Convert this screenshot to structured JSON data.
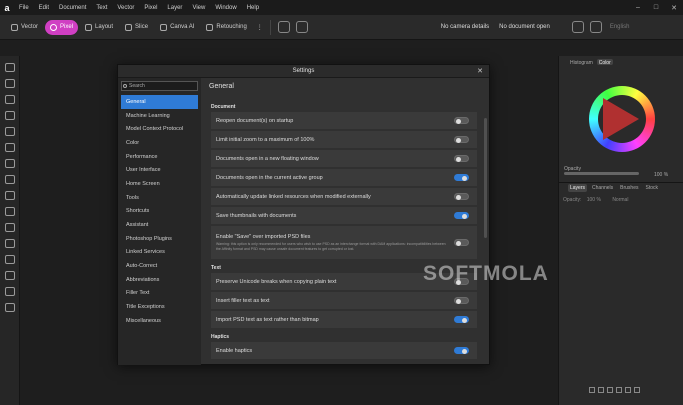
{
  "menubar": {
    "logo": "a",
    "items": [
      "File",
      "Edit",
      "Document",
      "Text",
      "Vector",
      "Pixel",
      "Layer",
      "View",
      "Window",
      "Help"
    ]
  },
  "toolbar": {
    "personas": [
      {
        "label": "Vector",
        "icon": "vector-icon"
      },
      {
        "label": "Pixel",
        "icon": "pixel-icon",
        "active": true
      },
      {
        "label": "Layout",
        "icon": "layout-icon"
      },
      {
        "label": "Slice",
        "icon": "slice-icon"
      },
      {
        "label": "Canva AI",
        "icon": "canva-ai-icon"
      },
      {
        "label": "Retouching",
        "icon": "retouching-icon"
      }
    ],
    "camera_details": "No camera details",
    "document_status": "No document open",
    "language": "English"
  },
  "right_panel": {
    "tabs": [
      "Histogram",
      "Color"
    ],
    "opacity_label": "Opacity",
    "opacity_value": "100 %",
    "layer_tabs": [
      "Layers",
      "Channels",
      "Brushes",
      "Stock"
    ],
    "opacity_small": "Opacity:",
    "opacity_small_value": "100 %",
    "blend_mode": "Normal"
  },
  "dialog": {
    "title": "Settings",
    "search_placeholder": "Search",
    "nav": [
      "General",
      "Machine Learning",
      "Model Context Protocol",
      "Color",
      "Performance",
      "User Interface",
      "Home Screen",
      "Tools",
      "Shortcuts",
      "Assistant",
      "Photoshop Plugins",
      "Linked Services",
      "Auto-Correct",
      "Abbreviations",
      "Filler Text",
      "Title Exceptions",
      "Miscellaneous"
    ],
    "content_title": "General",
    "sections": [
      {
        "title": "Document",
        "options": [
          {
            "label": "Reopen document(s) on startup",
            "on": false
          },
          {
            "label": "Limit initial zoom to a maximum of 100%",
            "on": false
          },
          {
            "label": "Documents open in a new floating window",
            "on": false
          },
          {
            "label": "Documents open in the current active group",
            "on": true
          },
          {
            "label": "Automatically update linked resources when modified externally",
            "on": false
          },
          {
            "label": "Save thumbnails with documents",
            "on": true
          },
          {
            "label": "Enable \"Save\" over imported PSD files",
            "note": "Warning: this option is only recommended for users who wish to use PSD as an interchange format with DAM applications: incompatibilities between the Affinity format and PSD may cause unsafe document features to get corrupted or lost.",
            "on": false
          }
        ]
      },
      {
        "title": "Text",
        "options": [
          {
            "label": "Preserve Unicode breaks when copying plain text",
            "on": false
          },
          {
            "label": "Insert filler text as text",
            "on": false
          },
          {
            "label": "Import PSD text as text rather than bitmap",
            "on": true
          }
        ]
      },
      {
        "title": "Haptics",
        "options": [
          {
            "label": "Enable haptics",
            "on": true
          }
        ]
      }
    ]
  },
  "watermark": "SOFTMOLA",
  "colors": {
    "accent": "#2f7bd6",
    "persona_active": "#d03fc3"
  }
}
